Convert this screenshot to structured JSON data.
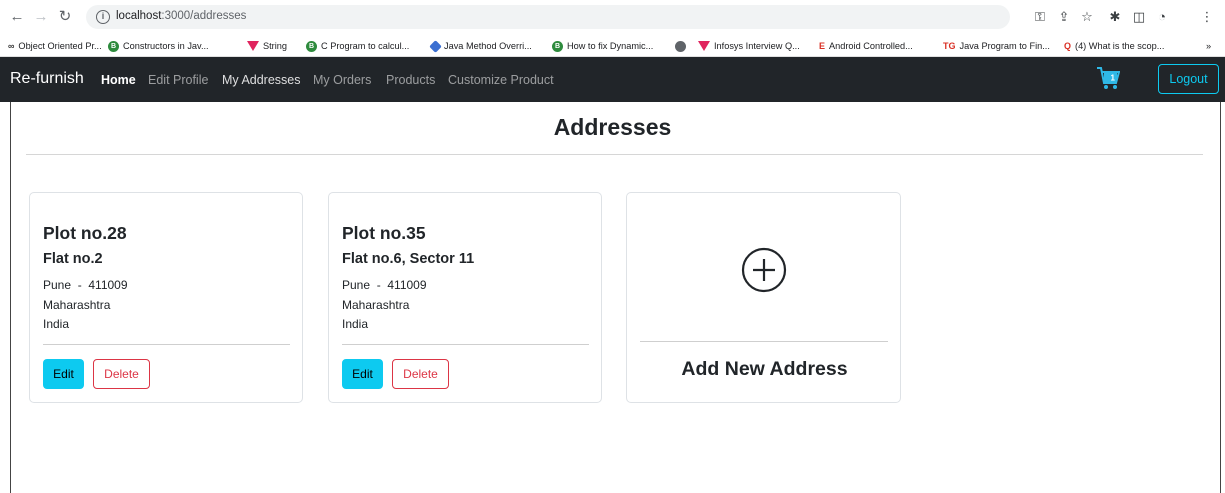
{
  "browser": {
    "url_host": "localhost",
    "url_path": ":3000/addresses",
    "bookmarks": [
      {
        "label": "Object Oriented Pr...",
        "icon": "oo-icon"
      },
      {
        "label": "Constructors in Jav...",
        "icon": "green-circle-icon"
      },
      {
        "label": "String",
        "icon": "red-triangle-icon"
      },
      {
        "label": "C Program to calcul...",
        "icon": "green-circle-icon"
      },
      {
        "label": "Java Method Overri...",
        "icon": "blue-diamond-icon"
      },
      {
        "label": "How to fix Dynamic...",
        "icon": "green-circle-icon"
      },
      {
        "label": "",
        "icon": "globe-icon"
      },
      {
        "label": "Infosys Interview Q...",
        "icon": "red-triangle-icon"
      },
      {
        "label": "Android Controlled...",
        "icon": "e-icon"
      },
      {
        "label": "Java Program to Fin...",
        "icon": "tg-icon"
      },
      {
        "label": "(4) What is the scop...",
        "icon": "q-icon"
      }
    ],
    "more": "»"
  },
  "navbar": {
    "brand": "Re-furnish",
    "links": [
      "Home",
      "Edit Profile",
      "My Addresses",
      "My Orders",
      "Products",
      "Customize Product"
    ],
    "logout": "Logout"
  },
  "page": {
    "title": "Addresses",
    "addresses": [
      {
        "line1": "Plot no.28",
        "line2": "Flat no.2",
        "city_zip": "Pune  -  411009",
        "state": "Maharashtra",
        "country": "India",
        "edit": "Edit",
        "delete": "Delete"
      },
      {
        "line1": "Plot no.35",
        "line2": "Flat no.6, Sector 11",
        "city_zip": "Pune  -  411009",
        "state": "Maharashtra",
        "country": "India",
        "edit": "Edit",
        "delete": "Delete"
      }
    ],
    "add_new": "Add New Address"
  },
  "colors": {
    "navbar_bg": "#212529",
    "accent": "#0dcaf0",
    "danger": "#dc3545"
  }
}
